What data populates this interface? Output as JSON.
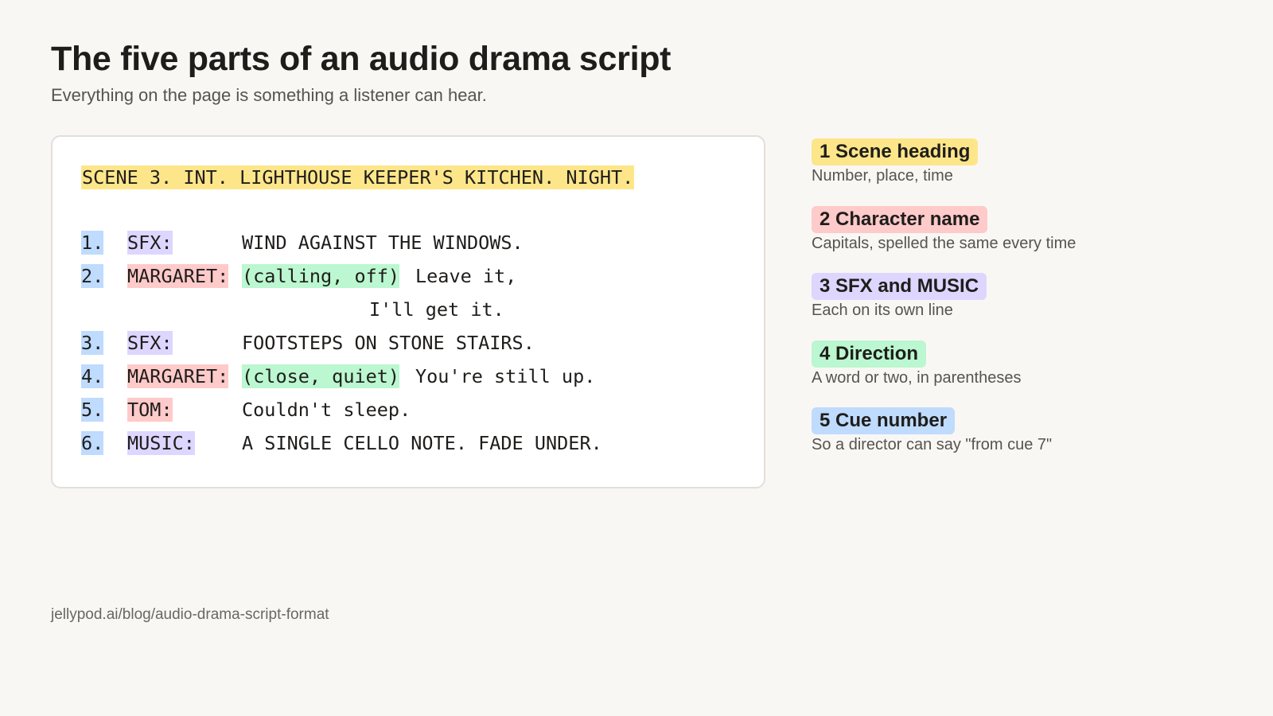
{
  "header": {
    "title": "The five parts of an audio drama script",
    "subtitle": "Everything on the page is something a listener can hear."
  },
  "script": {
    "scene_heading": "SCENE 3. INT. LIGHTHOUSE KEEPER'S KITCHEN. NIGHT.",
    "lines": [
      {
        "num": "1.",
        "who": "SFX:",
        "direction": "",
        "text": "WIND AGAINST THE WINDOWS."
      },
      {
        "num": "2.",
        "who": "MARGARET:",
        "direction": "(calling, off)",
        "text": "Leave it,",
        "continuation": "I'll get it."
      },
      {
        "num": "3.",
        "who": "SFX:",
        "direction": "",
        "text": "FOOTSTEPS ON STONE STAIRS."
      },
      {
        "num": "4.",
        "who": "MARGARET:",
        "direction": "(close, quiet)",
        "text": "You're still up."
      },
      {
        "num": "5.",
        "who": "TOM:",
        "direction": "",
        "text": "Couldn't sleep."
      },
      {
        "num": "6.",
        "who": "MUSIC:",
        "direction": "",
        "text": "A SINGLE CELLO NOTE. FADE UNDER."
      }
    ]
  },
  "legend": [
    {
      "label": "1 Scene heading",
      "desc": "Number, place, time",
      "color": "#fde68a"
    },
    {
      "label": "2 Character name",
      "desc": "Capitals, spelled the same every time",
      "color": "#fecaca"
    },
    {
      "label": "3 SFX and MUSIC",
      "desc": "Each on its own line",
      "color": "#ddd6fe"
    },
    {
      "label": "4 Direction",
      "desc": "A word or two, in parentheses",
      "color": "#bbf7d0"
    },
    {
      "label": "5 Cue number",
      "desc": "So a director can say \"from cue 7\"",
      "color": "#bfdbfe"
    }
  ],
  "footer": {
    "source": "jellypod.ai/blog/audio-drama-script-format"
  }
}
